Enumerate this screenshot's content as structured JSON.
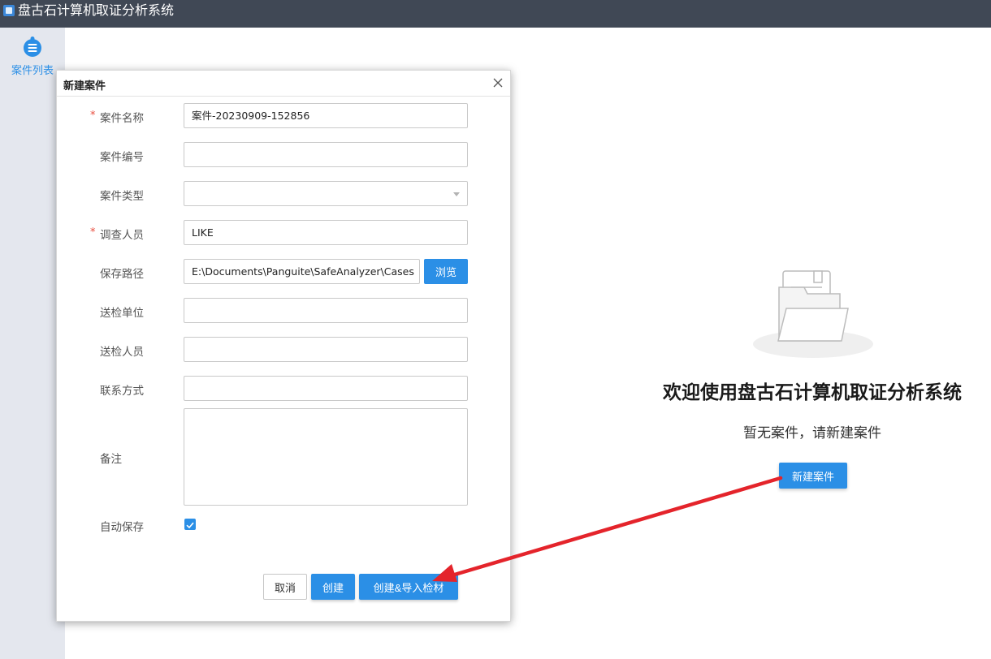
{
  "app": {
    "title": "盘古石计算机取证分析系统"
  },
  "sidebar": {
    "items": [
      {
        "label": "案件列表",
        "icon": "case-list-icon"
      }
    ]
  },
  "main": {
    "welcome_title": "欢迎使用盘古石计算机取证分析系统",
    "welcome_subtitle": "暂无案件，请新建案件",
    "new_case_button": "新建案件",
    "illustration_icon": "empty-folder-icon"
  },
  "dialog": {
    "title": "新建案件",
    "fields": {
      "case_name": {
        "label": "案件名称",
        "value": "案件-20230909-152856",
        "required": true
      },
      "case_number": {
        "label": "案件编号",
        "value": ""
      },
      "case_type": {
        "label": "案件类型",
        "value": ""
      },
      "investigator": {
        "label": "调查人员",
        "value": "LIKE",
        "required": true
      },
      "save_path": {
        "label": "保存路径",
        "value": "E:\\Documents\\Panguite\\SafeAnalyzer\\Cases",
        "browse_label": "浏览"
      },
      "submitting_unit": {
        "label": "送检单位",
        "value": ""
      },
      "submitter": {
        "label": "送检人员",
        "value": ""
      },
      "contact": {
        "label": "联系方式",
        "value": ""
      },
      "notes": {
        "label": "备注",
        "value": ""
      },
      "auto_save": {
        "label": "自动保存",
        "checked": true
      }
    },
    "buttons": {
      "cancel": "取消",
      "create": "创建",
      "create_import": "创建&导入检材"
    }
  },
  "colors": {
    "accent": "#2b8fe6",
    "titlebar": "#404855",
    "sidebar": "#e4e7ee",
    "annotation_arrow": "#e4242b",
    "required": "#e84c3d"
  },
  "required_marker": "*"
}
